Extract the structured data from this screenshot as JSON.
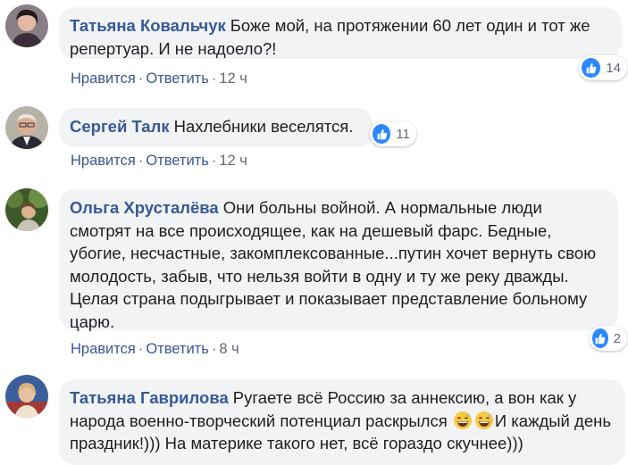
{
  "comments": [
    {
      "author": "Татьяна Ковальчук",
      "text": "Боже мой, на протяжении 60 лет один и тот же репертуар. И не надоело?!",
      "like_label": "Нравится",
      "reply_label": "Ответить",
      "time": "12 ч",
      "reactions": "14"
    },
    {
      "author": "Сергей Талк",
      "text": "Нахлебники веселятся.",
      "like_label": "Нравится",
      "reply_label": "Ответить",
      "time": "12 ч",
      "reactions": "11"
    },
    {
      "author": "Ольга Хрусталёва",
      "text": "Они больны войной. А нормальные люди смотрят на все происходящее, как на дешевый фарс. Бедные, убогие, несчастные, закомплексованные...путин хочет вернуть свою молодость, забыв, что нельзя войти в одну и ту же реку дважды. Целая страна подыгрывает и показывает представление больному царю.",
      "like_label": "Нравится",
      "reply_label": "Ответить",
      "time": "8 ч",
      "reactions": "2"
    },
    {
      "author": "Татьяна Гаврилова",
      "text_before_emoji": "Ругаете всё Россию за аннексию, а вон как у народа военно-творческий потенциал раскрылся ",
      "text_after_emoji": "И каждый день праздник!))) На материке такого нет, всё гораздо скучнее)))",
      "emoji": [
        "grinning-sweat-emoji",
        "grinning-sweat-emoji"
      ]
    }
  ],
  "separator": "·",
  "colors": {
    "author": "#385898",
    "bubble": "#f2f3f5",
    "meta": "#606770",
    "like_blue": "#2d88ff"
  }
}
